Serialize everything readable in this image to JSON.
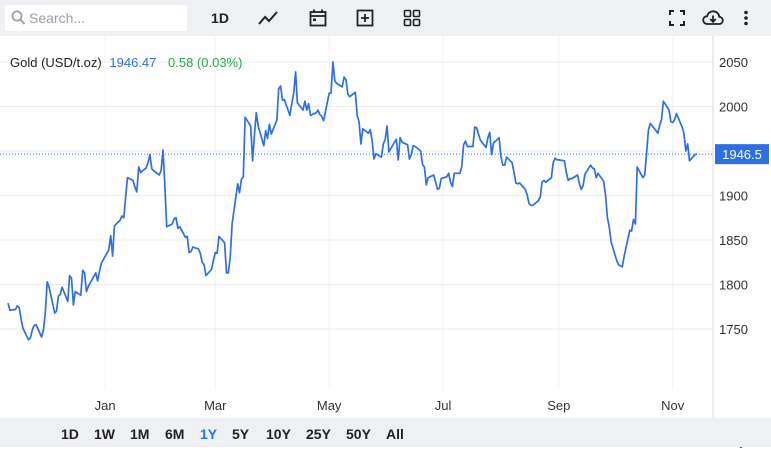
{
  "search": {
    "placeholder": "Search..."
  },
  "toolbar": {
    "interval_label": "1D"
  },
  "range_buttons": [
    "1D",
    "1W",
    "1M",
    "6M",
    "1Y",
    "5Y",
    "10Y",
    "25Y",
    "50Y",
    "All"
  ],
  "active_range": "1Y",
  "icons": {
    "line_chart": "line-chart-icon",
    "calendar": "calendar-icon",
    "add": "add-box-icon",
    "grid": "grid-icon",
    "fullscreen": "fullscreen-icon",
    "download": "cloud-download-icon",
    "more": "more-vert-icon",
    "settings": "gear-icon"
  },
  "legend": {
    "name": "Gold (USD/t.oz)",
    "price": "1946.47",
    "change": "0.58 (0.03%)"
  },
  "colors": {
    "line": "#2f6fe4",
    "change_positive": "#22a84a",
    "badge_bg": "#2f6fe4"
  },
  "chart_data": {
    "type": "line",
    "series": [
      {
        "name": "Gold (USD/t.oz)",
        "points": [
          [
            "2022-11-10",
            1779
          ],
          [
            "2022-11-11",
            1771
          ],
          [
            "2022-11-14",
            1772
          ],
          [
            "2022-11-15",
            1776
          ],
          [
            "2022-11-16",
            1774
          ],
          [
            "2022-11-17",
            1761
          ],
          [
            "2022-11-18",
            1751
          ],
          [
            "2022-11-21",
            1738
          ],
          [
            "2022-11-22",
            1740
          ],
          [
            "2022-11-23",
            1749
          ],
          [
            "2022-11-24",
            1754
          ],
          [
            "2022-11-25",
            1755
          ],
          [
            "2022-11-28",
            1741
          ],
          [
            "2022-11-29",
            1749
          ],
          [
            "2022-11-30",
            1768
          ],
          [
            "2022-12-01",
            1803
          ],
          [
            "2022-12-02",
            1797
          ],
          [
            "2022-12-05",
            1768
          ],
          [
            "2022-12-06",
            1770
          ],
          [
            "2022-12-07",
            1787
          ],
          [
            "2022-12-08",
            1789
          ],
          [
            "2022-12-09",
            1797
          ],
          [
            "2022-12-12",
            1781
          ],
          [
            "2022-12-13",
            1810
          ],
          [
            "2022-12-14",
            1807
          ],
          [
            "2022-12-15",
            1777
          ],
          [
            "2022-12-16",
            1792
          ],
          [
            "2022-12-19",
            1788
          ],
          [
            "2022-12-20",
            1816
          ],
          [
            "2022-12-21",
            1813
          ],
          [
            "2022-12-22",
            1792
          ],
          [
            "2022-12-23",
            1798
          ],
          [
            "2022-12-27",
            1813
          ],
          [
            "2022-12-28",
            1804
          ],
          [
            "2022-12-29",
            1815
          ],
          [
            "2022-12-30",
            1824
          ],
          [
            "2023-01-03",
            1839
          ],
          [
            "2023-01-04",
            1855
          ],
          [
            "2023-01-05",
            1832
          ],
          [
            "2023-01-06",
            1866
          ],
          [
            "2023-01-09",
            1872
          ],
          [
            "2023-01-10",
            1877
          ],
          [
            "2023-01-11",
            1875
          ],
          [
            "2023-01-12",
            1898
          ],
          [
            "2023-01-13",
            1920
          ],
          [
            "2023-01-16",
            1917
          ],
          [
            "2023-01-17",
            1909
          ],
          [
            "2023-01-18",
            1904
          ],
          [
            "2023-01-19",
            1932
          ],
          [
            "2023-01-20",
            1926
          ],
          [
            "2023-01-23",
            1931
          ],
          [
            "2023-01-24",
            1937
          ],
          [
            "2023-01-25",
            1946
          ],
          [
            "2023-01-26",
            1930
          ],
          [
            "2023-01-27",
            1928
          ],
          [
            "2023-01-30",
            1923
          ],
          [
            "2023-01-31",
            1928
          ],
          [
            "2023-02-01",
            1951
          ],
          [
            "2023-02-02",
            1913
          ],
          [
            "2023-02-03",
            1865
          ],
          [
            "2023-02-06",
            1868
          ],
          [
            "2023-02-07",
            1874
          ],
          [
            "2023-02-08",
            1875
          ],
          [
            "2023-02-09",
            1863
          ],
          [
            "2023-02-10",
            1865
          ],
          [
            "2023-02-13",
            1853
          ],
          [
            "2023-02-14",
            1854
          ],
          [
            "2023-02-15",
            1836
          ],
          [
            "2023-02-16",
            1837
          ],
          [
            "2023-02-17",
            1842
          ],
          [
            "2023-02-20",
            1840
          ],
          [
            "2023-02-21",
            1835
          ],
          [
            "2023-02-22",
            1825
          ],
          [
            "2023-02-23",
            1822
          ],
          [
            "2023-02-24",
            1810
          ],
          [
            "2023-02-27",
            1817
          ],
          [
            "2023-02-28",
            1827
          ],
          [
            "2023-03-01",
            1836
          ],
          [
            "2023-03-02",
            1835
          ],
          [
            "2023-03-03",
            1854
          ],
          [
            "2023-03-06",
            1847
          ],
          [
            "2023-03-07",
            1813
          ],
          [
            "2023-03-08",
            1813
          ],
          [
            "2023-03-09",
            1830
          ],
          [
            "2023-03-10",
            1868
          ],
          [
            "2023-03-13",
            1913
          ],
          [
            "2023-03-14",
            1903
          ],
          [
            "2023-03-15",
            1918
          ],
          [
            "2023-03-16",
            1921
          ],
          [
            "2023-03-17",
            1988
          ],
          [
            "2023-03-20",
            1978
          ],
          [
            "2023-03-21",
            1939
          ],
          [
            "2023-03-22",
            1969
          ],
          [
            "2023-03-23",
            1993
          ],
          [
            "2023-03-24",
            1978
          ],
          [
            "2023-03-27",
            1956
          ],
          [
            "2023-03-28",
            1973
          ],
          [
            "2023-03-29",
            1964
          ],
          [
            "2023-03-30",
            1980
          ],
          [
            "2023-03-31",
            1969
          ],
          [
            "2023-04-03",
            1985
          ],
          [
            "2023-04-04",
            2020
          ],
          [
            "2023-04-05",
            2023
          ],
          [
            "2023-04-06",
            2007
          ],
          [
            "2023-04-07",
            2008
          ],
          [
            "2023-04-10",
            1990
          ],
          [
            "2023-04-11",
            2003
          ],
          [
            "2023-04-12",
            2015
          ],
          [
            "2023-04-13",
            2039
          ],
          [
            "2023-04-14",
            2004
          ],
          [
            "2023-04-17",
            1996
          ],
          [
            "2023-04-18",
            2006
          ],
          [
            "2023-04-19",
            1996
          ],
          [
            "2023-04-20",
            2003
          ],
          [
            "2023-04-21",
            1990
          ],
          [
            "2023-04-24",
            1993
          ],
          [
            "2023-04-25",
            1996
          ],
          [
            "2023-04-26",
            1991
          ],
          [
            "2023-04-27",
            1989
          ],
          [
            "2023-04-28",
            1984
          ],
          [
            "2023-05-01",
            2015
          ],
          [
            "2023-05-02",
            2015
          ],
          [
            "2023-05-03",
            2050
          ],
          [
            "2023-05-04",
            2029
          ],
          [
            "2023-05-05",
            2026
          ],
          [
            "2023-05-08",
            2022
          ],
          [
            "2023-05-09",
            2033
          ],
          [
            "2023-05-10",
            2030
          ],
          [
            "2023-05-11",
            2014
          ],
          [
            "2023-05-12",
            2011
          ],
          [
            "2023-05-15",
            2016
          ],
          [
            "2023-05-16",
            1990
          ],
          [
            "2023-05-17",
            1983
          ],
          [
            "2023-05-18",
            1958
          ],
          [
            "2023-05-19",
            1975
          ],
          [
            "2023-05-22",
            1970
          ],
          [
            "2023-05-23",
            1974
          ],
          [
            "2023-05-24",
            1962
          ],
          [
            "2023-05-25",
            1941
          ],
          [
            "2023-05-26",
            1947
          ],
          [
            "2023-05-29",
            1943
          ],
          [
            "2023-05-30",
            1958
          ],
          [
            "2023-05-31",
            1963
          ],
          [
            "2023-06-01",
            1978
          ],
          [
            "2023-06-02",
            1949
          ],
          [
            "2023-06-05",
            1960
          ],
          [
            "2023-06-06",
            1963
          ],
          [
            "2023-06-07",
            1940
          ],
          [
            "2023-06-08",
            1965
          ],
          [
            "2023-06-09",
            1960
          ],
          [
            "2023-06-12",
            1957
          ],
          [
            "2023-06-13",
            1941
          ],
          [
            "2023-06-14",
            1946
          ],
          [
            "2023-06-15",
            1956
          ],
          [
            "2023-06-16",
            1955
          ],
          [
            "2023-06-19",
            1950
          ],
          [
            "2023-06-20",
            1935
          ],
          [
            "2023-06-21",
            1932
          ],
          [
            "2023-06-22",
            1912
          ],
          [
            "2023-06-23",
            1920
          ],
          [
            "2023-06-26",
            1923
          ],
          [
            "2023-06-27",
            1915
          ],
          [
            "2023-06-28",
            1907
          ],
          [
            "2023-06-29",
            1908
          ],
          [
            "2023-06-30",
            1919
          ],
          [
            "2023-07-03",
            1921
          ],
          [
            "2023-07-04",
            1925
          ],
          [
            "2023-07-05",
            1915
          ],
          [
            "2023-07-06",
            1910
          ],
          [
            "2023-07-07",
            1925
          ],
          [
            "2023-07-10",
            1925
          ],
          [
            "2023-07-11",
            1932
          ],
          [
            "2023-07-12",
            1957
          ],
          [
            "2023-07-13",
            1961
          ],
          [
            "2023-07-14",
            1955
          ],
          [
            "2023-07-17",
            1955
          ],
          [
            "2023-07-18",
            1977
          ],
          [
            "2023-07-19",
            1976
          ],
          [
            "2023-07-20",
            1969
          ],
          [
            "2023-07-21",
            1962
          ],
          [
            "2023-07-24",
            1954
          ],
          [
            "2023-07-25",
            1965
          ],
          [
            "2023-07-26",
            1971
          ],
          [
            "2023-07-27",
            1946
          ],
          [
            "2023-07-28",
            1959
          ],
          [
            "2023-07-31",
            1965
          ],
          [
            "2023-08-01",
            1944
          ],
          [
            "2023-08-02",
            1934
          ],
          [
            "2023-08-03",
            1934
          ],
          [
            "2023-08-04",
            1943
          ],
          [
            "2023-08-07",
            1937
          ],
          [
            "2023-08-08",
            1926
          ],
          [
            "2023-08-09",
            1914
          ],
          [
            "2023-08-10",
            1913
          ],
          [
            "2023-08-11",
            1914
          ],
          [
            "2023-08-14",
            1907
          ],
          [
            "2023-08-15",
            1901
          ],
          [
            "2023-08-16",
            1891
          ],
          [
            "2023-08-17",
            1889
          ],
          [
            "2023-08-18",
            1889
          ],
          [
            "2023-08-21",
            1894
          ],
          [
            "2023-08-22",
            1898
          ],
          [
            "2023-08-23",
            1915
          ],
          [
            "2023-08-24",
            1917
          ],
          [
            "2023-08-25",
            1915
          ],
          [
            "2023-08-28",
            1920
          ],
          [
            "2023-08-29",
            1937
          ],
          [
            "2023-08-30",
            1942
          ],
          [
            "2023-08-31",
            1940
          ],
          [
            "2023-09-01",
            1940
          ],
          [
            "2023-09-04",
            1939
          ],
          [
            "2023-09-05",
            1926
          ],
          [
            "2023-09-06",
            1917
          ],
          [
            "2023-09-07",
            1919
          ],
          [
            "2023-09-08",
            1919
          ],
          [
            "2023-09-11",
            1923
          ],
          [
            "2023-09-12",
            1913
          ],
          [
            "2023-09-13",
            1907
          ],
          [
            "2023-09-14",
            1911
          ],
          [
            "2023-09-15",
            1924
          ],
          [
            "2023-09-18",
            1934
          ],
          [
            "2023-09-19",
            1931
          ],
          [
            "2023-09-20",
            1930
          ],
          [
            "2023-09-21",
            1920
          ],
          [
            "2023-09-22",
            1925
          ],
          [
            "2023-09-25",
            1916
          ],
          [
            "2023-09-26",
            1901
          ],
          [
            "2023-09-27",
            1875
          ],
          [
            "2023-09-28",
            1865
          ],
          [
            "2023-09-29",
            1848
          ],
          [
            "2023-10-02",
            1827
          ],
          [
            "2023-10-03",
            1822
          ],
          [
            "2023-10-04",
            1821
          ],
          [
            "2023-10-05",
            1820
          ],
          [
            "2023-10-06",
            1832
          ],
          [
            "2023-10-09",
            1861
          ],
          [
            "2023-10-10",
            1860
          ],
          [
            "2023-10-11",
            1873
          ],
          [
            "2023-10-12",
            1868
          ],
          [
            "2023-10-13",
            1932
          ],
          [
            "2023-10-16",
            1920
          ],
          [
            "2023-10-17",
            1923
          ],
          [
            "2023-10-18",
            1948
          ],
          [
            "2023-10-19",
            1974
          ],
          [
            "2023-10-20",
            1981
          ],
          [
            "2023-10-23",
            1973
          ],
          [
            "2023-10-24",
            1970
          ],
          [
            "2023-10-25",
            1979
          ],
          [
            "2023-10-26",
            1985
          ],
          [
            "2023-10-27",
            2006
          ],
          [
            "2023-10-30",
            1996
          ],
          [
            "2023-10-31",
            1983
          ],
          [
            "2023-11-01",
            1982
          ],
          [
            "2023-11-02",
            1985
          ],
          [
            "2023-11-03",
            1992
          ],
          [
            "2023-11-06",
            1977
          ],
          [
            "2023-11-07",
            1970
          ],
          [
            "2023-11-08",
            1950
          ],
          [
            "2023-11-09",
            1958
          ],
          [
            "2023-11-10",
            1939
          ],
          [
            "2023-11-13",
            1946
          ],
          [
            "2023-11-14",
            1946.47
          ]
        ]
      }
    ],
    "x_ticks": [
      "Jan",
      "Mar",
      "May",
      "Jul",
      "Sep",
      "Nov"
    ],
    "x_tick_dates": [
      "2023-01-01",
      "2023-03-01",
      "2023-05-01",
      "2023-07-01",
      "2023-09-01",
      "2023-11-01"
    ],
    "x_range": [
      "2022-11-10",
      "2023-11-24"
    ],
    "y_ticks": [
      1750,
      1800,
      1850,
      1900,
      1950,
      2000,
      2050
    ],
    "ylim": [
      1705,
      2070
    ],
    "last_value_label": "1946.5",
    "grid": true
  }
}
